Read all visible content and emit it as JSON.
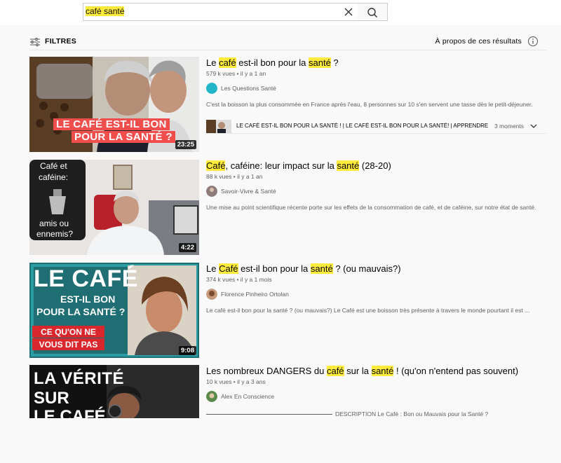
{
  "search": {
    "query": "café santé",
    "clear_icon": "close-icon",
    "search_icon": "search-icon"
  },
  "filters": {
    "label": "FILTRES",
    "about": "À propos de ces résultats"
  },
  "results": [
    {
      "title_parts": [
        "Le ",
        "café",
        " est-il bon pour la ",
        "santé",
        " ?"
      ],
      "meta": "579 k vues • il y a 1 an",
      "channel": "Les Questions Santé",
      "avatar_color": "#22b5c6",
      "description": "C'est la boisson la plus consommée en France après l'eau, 8 personnes sur 10 s'en servent une tasse dès le petit-déjeuner.",
      "duration": "23:25",
      "thumb_caption_1": "LE CAFÉ EST-IL BON",
      "thumb_caption_2": "POUR LA SANTÉ ?",
      "chapter_text": "LE CAFÉ EST-IL BON POUR LA SANTÉ ! | LE CAFÉ EST-IL BON POUR LA SANTÉ! | APPRENDRE À FAIR...",
      "chapter_count": "3 moments"
    },
    {
      "title_parts": [
        "Café",
        ", caféine: leur impact sur la ",
        "santé",
        " (28-20)"
      ],
      "meta": "88 k vues • il y a 1 an",
      "channel": "Savoir-Vivre & Santé",
      "avatar_color": "#8e7a78",
      "description": "Une mise au point scientifique récente porte sur les effets de la consommation de café, et de caféine, sur notre état de santé.",
      "duration": "4:22",
      "thumb_caption_1": "Café et",
      "thumb_caption_2": "caféine:",
      "thumb_caption_3": "amis ou",
      "thumb_caption_4": "ennemis?"
    },
    {
      "title_parts": [
        "Le ",
        "Café",
        " est-il bon pour la ",
        "santé",
        " ? (ou mauvais?)"
      ],
      "meta": "374 k vues • il y a 1 mois",
      "channel": "Florence Pinheiro Ortolan",
      "avatar_color": "#c89a7c",
      "description": "Le café est-il bon pour la santé ? (ou mauvais?) Le Café est une boisson très présente à travers le monde pourtant il est ...",
      "duration": "9:08",
      "thumb_caption_1": "LE CAFÉ",
      "thumb_caption_2": "EST-IL BON",
      "thumb_caption_3": "POUR LA SANTÉ ?",
      "thumb_caption_4": "CE QU'ON NE",
      "thumb_caption_5": "VOUS DIT PAS"
    },
    {
      "title_parts": [
        "Les nombreux DANGERS du ",
        "café",
        " sur la ",
        "santé",
        " ! (qu'on n'entend pas souvent)"
      ],
      "meta": "10 k vues • il y a 3 ans",
      "channel": "Alex En Conscience",
      "avatar_color": "#5a8a4a",
      "description": "DESCRIPTION Le Café : Bon ou Mauvais pour la Santé ?",
      "thumb_caption_1": "LA VÉRITÉ",
      "thumb_caption_2": "SUR",
      "thumb_caption_3": "LE CAFÉ"
    }
  ]
}
